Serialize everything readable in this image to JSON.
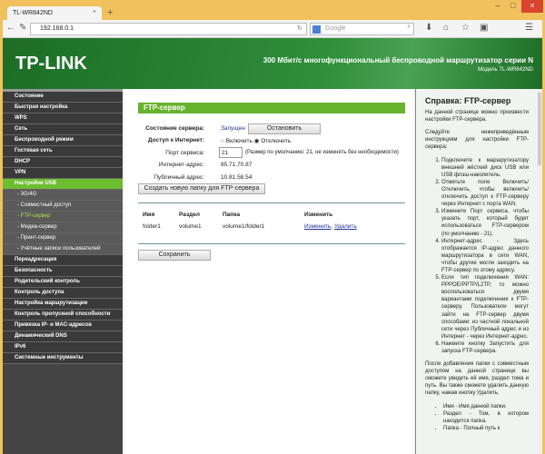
{
  "browser": {
    "tab_title": "TL-WR842ND",
    "url": "192.168.0.1",
    "search_placeholder": "Google"
  },
  "header": {
    "logo": "TP-LINK",
    "title": "300 Мбит/с многофункциональный беспроводной маршрутизатор серии N",
    "model": "Модель TL-WR842ND"
  },
  "sidebar": {
    "items": [
      {
        "label": "Состояние",
        "type": "main"
      },
      {
        "label": "Быстрая настройка",
        "type": "main"
      },
      {
        "label": "WPS",
        "type": "main"
      },
      {
        "label": "Сеть",
        "type": "main"
      },
      {
        "label": "Беспроводной режим",
        "type": "main"
      },
      {
        "label": "Гостевая сеть",
        "type": "main"
      },
      {
        "label": "DHCP",
        "type": "main"
      },
      {
        "label": "VPN",
        "type": "main"
      },
      {
        "label": "Настройки USB",
        "type": "active"
      },
      {
        "label": "- 3G/4G",
        "type": "sub"
      },
      {
        "label": "- Совместный доступ",
        "type": "sub"
      },
      {
        "label": "- FTP-сервер",
        "type": "cur"
      },
      {
        "label": "- Медиа-сервер",
        "type": "sub"
      },
      {
        "label": "- Принт-сервер",
        "type": "sub"
      },
      {
        "label": "- Учётные записи пользователей",
        "type": "sub"
      },
      {
        "label": "Переадресация",
        "type": "main"
      },
      {
        "label": "Безопасность",
        "type": "main"
      },
      {
        "label": "Родительский контроль",
        "type": "main"
      },
      {
        "label": "Контроль доступа",
        "type": "main"
      },
      {
        "label": "Настройка маршрутизации",
        "type": "main"
      },
      {
        "label": "Контроль пропускной способности",
        "type": "main"
      },
      {
        "label": "Привязка IP- и MAC-адресов",
        "type": "main"
      },
      {
        "label": "Динамический DNS",
        "type": "main"
      },
      {
        "label": "IPv6",
        "type": "main"
      },
      {
        "label": "Системные инструменты",
        "type": "main"
      }
    ]
  },
  "main": {
    "title": "FTP-сервер",
    "server_status_label": "Состояние сервера:",
    "server_status": "Запущен",
    "stop_button": "Остановить",
    "internet_access_label": "Доступ к Интернет:",
    "enable": "Включить",
    "disable": "Отключить",
    "port_label": "Порт сервиса:",
    "port": "21",
    "port_hint": "(Размер по умолчанию: 21, не изменять без необходимости)",
    "internet_address_label": "Интернет-адрес:",
    "internet_address": "85.71.70.87",
    "public_address_label": "Публичный адрес:",
    "public_address": "10.81.58.54",
    "create_folder_button": "Создать новую папку для FTP-сервера",
    "table": {
      "headers": [
        "Имя",
        "Раздел",
        "Папка",
        "Изменить"
      ],
      "rows": [
        {
          "name": "folder1",
          "volume": "volume1",
          "folder": "volume1/folder1",
          "edit": "Изменить",
          "delete": "Удалить"
        }
      ]
    },
    "save_button": "Сохранить"
  },
  "help": {
    "title": "Справка: FTP-сервер",
    "intro": "На данной странице можно произвести настройки FTP-сервера.",
    "follow": "Следуйте нижеприведённым инструкциям для настройки FTP-сервера:",
    "steps": [
      "Подключите к маршрутизатору внешний жёсткий диск USB или USB флэш-накопитель.",
      "Отметьте поле Включить/Отключить, чтобы включить/отключить доступ к FTP-серверу через Интернет с порта WAN.",
      "Измените Порт сервиса, чтобы указать порт, который будет использоваться FTP-сервером (по умолчанию - 21).",
      "Интернет-адрес - Здесь отображается IP-адрес данного маршрутизатора в сети WAN, чтобы другие могли заходить на FTP-сервер по этому адресу.",
      "Если тип подключения WAN: PPPOE/PPTP/L2TP, то можно воспользоваться двумя вариантами подключения к FTP-серверу. Пользователи могут зайти на FTP-сервер двумя способами: из частной локальной сети через Публичный адрес и из Интернет - через Интернет-адрес.",
      "Нажмите кнопку Запустить для запуска FTP-сервера."
    ],
    "after": "После добавления папки с совместным доступом на данной странице вы сможете увидеть её имя, раздел тома и путь. Вы также сможете удалить данную папку, нажав кнопку Удалить.",
    "bullets": [
      "Имя - Имя данной папки.",
      "Раздел - Том, в котором находится папка.",
      "Папка - Полный путь к"
    ]
  }
}
